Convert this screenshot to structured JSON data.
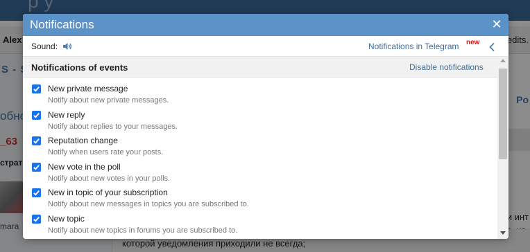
{
  "background": {
    "top_text": "p     y",
    "user": "Alex",
    "credits": "redits.",
    "sidebar_text_1": "S - S",
    "sidebar_text_2": "обно",
    "sidebar_text_3": "_63",
    "sidebar_text_4": "страт",
    "sidebar_text_5": "mara",
    "right_text_1": "Po",
    "right_text_2": "и инт",
    "right_text_3": "а, из-",
    "bottom_line": "которой уведомления приходили не всегда;"
  },
  "dialog": {
    "title": "Notifications",
    "close_glyph": "✕",
    "sound_label": "Sound:",
    "telegram_link": "Notifications in Telegram",
    "new_badge": "new",
    "events_title": "Notifications of events",
    "disable_link": "Disable notifications",
    "events": [
      {
        "name": "New private message",
        "description": "Notify about new private messages.",
        "checked": true
      },
      {
        "name": "New reply",
        "description": "Notify about replies to your messages.",
        "checked": true
      },
      {
        "name": "Reputation change",
        "description": "Notify when users rate your posts.",
        "checked": true
      },
      {
        "name": "New vote in the poll",
        "description": "Notify about new votes in your polls.",
        "checked": true
      },
      {
        "name": "New in topic of your subscription",
        "description": "Notify about new messages in topics you are subscribed to.",
        "checked": true
      },
      {
        "name": "New topic",
        "description": "Notify about new topics in forums you are subscribed to.",
        "checked": true
      }
    ]
  },
  "colors": {
    "header": "#5b93c9",
    "link": "#3e6e9e",
    "checkbox": "#1a73e8",
    "badge": "#e01515"
  },
  "icons": {
    "sound": "speaker-icon",
    "back": "chevron-left-icon",
    "close": "close-icon",
    "check": "checkmark-icon"
  }
}
